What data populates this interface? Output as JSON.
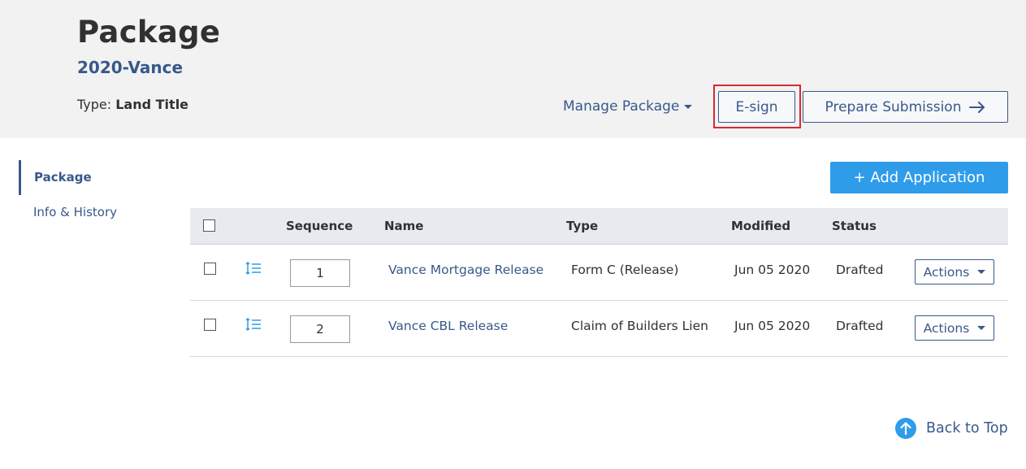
{
  "header": {
    "title": "Package",
    "package_name": "2020-Vance",
    "type_label": "Type:",
    "type_value": "Land Title",
    "manage_package": "Manage Package",
    "esign": "E-sign",
    "prepare_submission": "Prepare Submission"
  },
  "sidenav": {
    "items": [
      {
        "label": "Package",
        "active": true
      },
      {
        "label": "Info & History",
        "active": false
      }
    ]
  },
  "add_application": "+ Add Application",
  "table": {
    "columns": [
      "Sequence",
      "Name",
      "Type",
      "Modified",
      "Status"
    ],
    "rows": [
      {
        "sequence": "1",
        "name": "Vance Mortgage Release",
        "type": "Form C (Release)",
        "modified": "Jun 05 2020",
        "status": "Drafted",
        "actions": "Actions"
      },
      {
        "sequence": "2",
        "name": "Vance CBL Release",
        "type": "Claim of Builders Lien",
        "modified": "Jun 05 2020",
        "status": "Drafted",
        "actions": "Actions"
      }
    ]
  },
  "back_to_top": "Back to Top",
  "colors": {
    "brand": "#38598a",
    "accent_button": "#2f9cea",
    "highlight": "#d8292f",
    "header_bg": "#f2f2f2"
  }
}
